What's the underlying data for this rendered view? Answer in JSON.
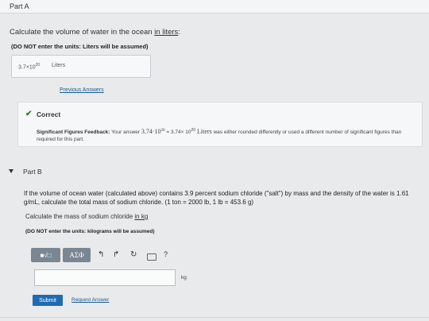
{
  "part_a": {
    "title": "Part A",
    "question_prefix": "Calculate the volume of water in the ocean ",
    "question_link": "in liters",
    "question_suffix": ":",
    "directions": "(DO NOT enter the units: Liters will be assumed)",
    "answer_value": "3.7×10",
    "answer_exponent": "20",
    "answer_unit": "Liters",
    "previous_answers": "Previous Answers"
  },
  "feedback": {
    "status": "Correct",
    "heading": "Significant Figures Feedback:",
    "text_1": " Your answer ",
    "your_answer": "3.74·10",
    "your_answer_exp": "20",
    "text_2": " = 3.74× 10",
    "text_2_exp": "20",
    "unit_word": " Liters",
    "text_3": " was either rounded differently or used a different number of significant figures than required for this part."
  },
  "part_b": {
    "title": "Part B",
    "question": "If the volume of ocean water (calculated above) contains 3.9 percent sodium chloride (\"salt\") by mass and the density of the water is 1.61 g/mL, calculate the total mass of sodium chloride. (1 ton = 2000 lb, 1 lb = 453.6 g)",
    "sub_prefix": "Calculate the mass of sodium chloride ",
    "sub_link": "in kg",
    "directions": "(DO NOT enter the units: kilograms will be assumed)",
    "unit": "kg",
    "submit": "Submit",
    "request_answer": "Request Answer"
  },
  "toolbar": {
    "matrix_label": "■√□",
    "greek_label": "AΣΦ",
    "undo": "↰",
    "redo": "↱",
    "reset": "↻",
    "help": "?"
  },
  "icons": {
    "check": "check-icon",
    "expand": "triangle-down-icon"
  },
  "colors": {
    "correct_green": "#2e7d32",
    "submit_blue": "#1f6bb3",
    "link_blue": "#1a5b94"
  }
}
